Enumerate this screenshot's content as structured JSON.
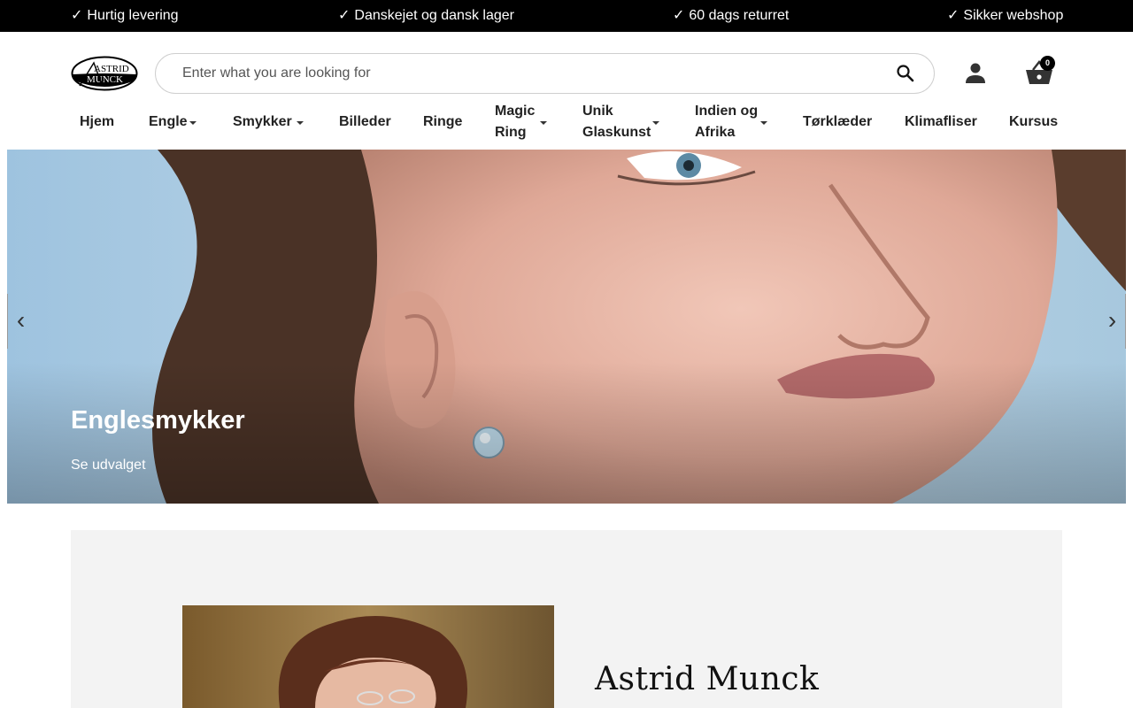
{
  "usp": [
    {
      "check": "✓",
      "text": "Hurtig levering"
    },
    {
      "check": "✓",
      "text": "Danskejet og dansk lager"
    },
    {
      "check": "✓",
      "text": "60 dags returret"
    },
    {
      "check": "✓",
      "text": "Sikker webshop"
    }
  ],
  "header": {
    "logo_text_line1": "ASTRID",
    "logo_text_line2": "MUNCK",
    "search_placeholder": "Enter what you are looking for",
    "search_value": "",
    "cart_count": "0"
  },
  "nav": [
    {
      "label": "Hjem",
      "dropdown": false
    },
    {
      "label": "Engle",
      "dropdown": true
    },
    {
      "label": "Smykker",
      "dropdown": true
    },
    {
      "label": "Billeder",
      "dropdown": false
    },
    {
      "label": "Ringe",
      "dropdown": false
    },
    {
      "label_line1": "Magic",
      "label_line2": "Ring",
      "dropdown": true
    },
    {
      "label_line1": "Unik",
      "label_line2": "Glaskunst",
      "dropdown": true
    },
    {
      "label_line1": "Indien og",
      "label_line2": "Afrika",
      "dropdown": true
    },
    {
      "label": "Tørklæder",
      "dropdown": false
    },
    {
      "label": "Klimafliser",
      "dropdown": false
    },
    {
      "label": "Kursus",
      "dropdown": false
    }
  ],
  "hero": {
    "title": "Englesmykker",
    "link": "Se udvalget",
    "prev": "‹",
    "next": "›"
  },
  "about": {
    "name": "Astrid Munck"
  },
  "colors": {
    "top_bar": "#000000",
    "about_bg": "#f3f3f3",
    "text": "#222222"
  },
  "icons": [
    "search-icon",
    "account-icon",
    "cart-icon",
    "chevron-left-icon",
    "chevron-right-icon",
    "caret-down-icon"
  ]
}
